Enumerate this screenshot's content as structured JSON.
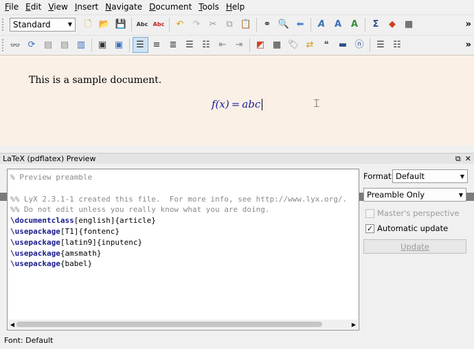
{
  "menu": [
    {
      "label": "File",
      "key": "F",
      "rest": "ile"
    },
    {
      "label": "Edit",
      "key": "E",
      "rest": "dit"
    },
    {
      "label": "View",
      "key": "V",
      "rest": "iew"
    },
    {
      "label": "Insert",
      "key": "I",
      "rest": "nsert"
    },
    {
      "label": "Navigate",
      "key": "N",
      "rest": "avigate"
    },
    {
      "label": "Document",
      "key": "D",
      "rest": "ocument"
    },
    {
      "label": "Tools",
      "key": "T",
      "rest": "ools"
    },
    {
      "label": "Help",
      "key": "H",
      "rest": "elp"
    }
  ],
  "toolbar": {
    "layout_combo": "Standard",
    "more": "»"
  },
  "document": {
    "text": "This is a sample document.",
    "math_lhs": "f(x)",
    "math_eq": "=",
    "math_rhs": "abc"
  },
  "preview": {
    "title": "LaTeX (pdflatex) Preview",
    "lines": [
      {
        "kind": "comment",
        "text": "% Preview preamble"
      },
      {
        "kind": "blank",
        "text": ""
      },
      {
        "kind": "comment",
        "text": "%% LyX 2.3.1-1 created this file.  For more info, see http://www.lyx.org/."
      },
      {
        "kind": "comment",
        "text": "%% Do not edit unless you really know what you are doing."
      },
      {
        "kind": "cmd",
        "cmd": "\\documentclass",
        "rest": "[english]{article}"
      },
      {
        "kind": "cmd",
        "cmd": "\\usepackage",
        "rest": "[T1]{fontenc}"
      },
      {
        "kind": "cmd",
        "cmd": "\\usepackage",
        "rest": "[latin9]{inputenc}"
      },
      {
        "kind": "cmd",
        "cmd": "\\usepackage",
        "rest": "{amsmath}"
      },
      {
        "kind": "cmd",
        "cmd": "\\usepackage",
        "rest": "{babel}"
      }
    ],
    "format_label": "Format:",
    "format_value": "Default",
    "content_value": "Preamble Only",
    "masters_perspective": "Master's perspective",
    "automatic_update": "Automatic update",
    "automatic_update_checked": true,
    "update_button": "Update"
  },
  "status": {
    "text": "Font: Default"
  }
}
